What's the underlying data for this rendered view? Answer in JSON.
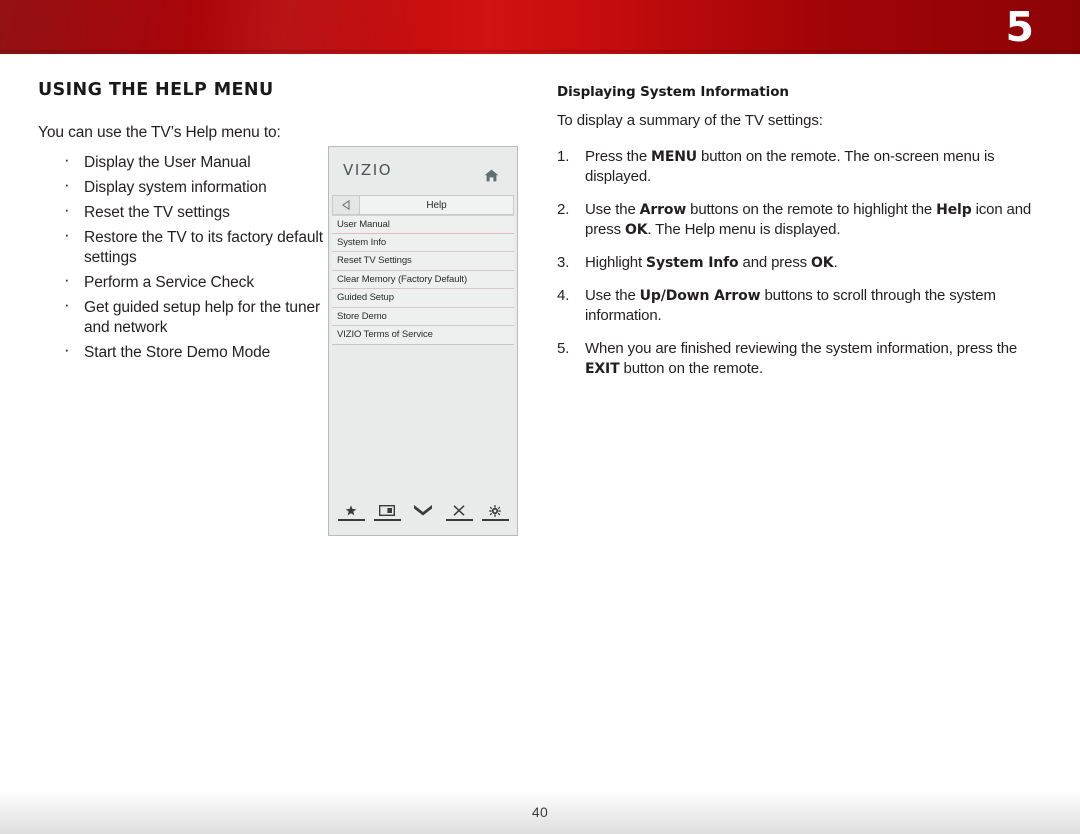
{
  "header": {
    "chapter_number": "5",
    "band_color": "#c00a0c"
  },
  "left_column": {
    "section_title": "USING THE HELP MENU",
    "lead_line": "You can use the TV’s Help menu to:",
    "features": [
      "Display the User Manual",
      "Display system information",
      "Reset the TV settings",
      "Restore the TV to its factory default settings",
      "Perform a Service Check",
      "Get guided setup help for the tuner and network",
      "Start the Store Demo Mode"
    ]
  },
  "tv_menu": {
    "brand": "VIZIO",
    "home_icon": "home-icon",
    "back_icon": "back-arrow-icon",
    "title": "Help",
    "items": [
      "User Manual",
      "System Info",
      "Reset TV Settings",
      "Clear Memory (Factory Default)",
      "Guided Setup",
      "Store Demo",
      "VIZIO Terms of Service"
    ],
    "footer_icons": [
      "star-icon",
      "picture-icon",
      "double-chevron-down-icon",
      "close-x-icon",
      "gear-icon"
    ]
  },
  "right_column": {
    "sub_title": "Displaying System Information",
    "intro_line": "To display a summary of the TV settings:",
    "steps": [
      {
        "parts": [
          {
            "text": "Press the ",
            "bold": false
          },
          {
            "text": "MENU",
            "bold": true
          },
          {
            "text": " button on the remote. The on-screen menu is displayed.",
            "bold": false
          }
        ]
      },
      {
        "parts": [
          {
            "text": "Use the ",
            "bold": false
          },
          {
            "text": "Arrow",
            "bold": true
          },
          {
            "text": " buttons on the remote to highlight the ",
            "bold": false
          },
          {
            "text": "Help",
            "bold": true
          },
          {
            "text": " icon and press ",
            "bold": false
          },
          {
            "text": "OK",
            "bold": true
          },
          {
            "text": ". The Help menu is displayed.",
            "bold": false
          }
        ]
      },
      {
        "parts": [
          {
            "text": "Highlight ",
            "bold": false
          },
          {
            "text": "System Info",
            "bold": true
          },
          {
            "text": " and press ",
            "bold": false
          },
          {
            "text": "OK",
            "bold": true
          },
          {
            "text": ".",
            "bold": false
          }
        ]
      },
      {
        "parts": [
          {
            "text": "Use the ",
            "bold": false
          },
          {
            "text": "Up/Down Arrow",
            "bold": true
          },
          {
            "text": " buttons to scroll through the system information.",
            "bold": false
          }
        ]
      },
      {
        "parts": [
          {
            "text": "When you are finished reviewing the system information, press the ",
            "bold": false
          },
          {
            "text": "EXIT",
            "bold": true
          },
          {
            "text": " button on the remote.",
            "bold": false
          }
        ]
      }
    ]
  },
  "footer": {
    "page_number": "40"
  }
}
